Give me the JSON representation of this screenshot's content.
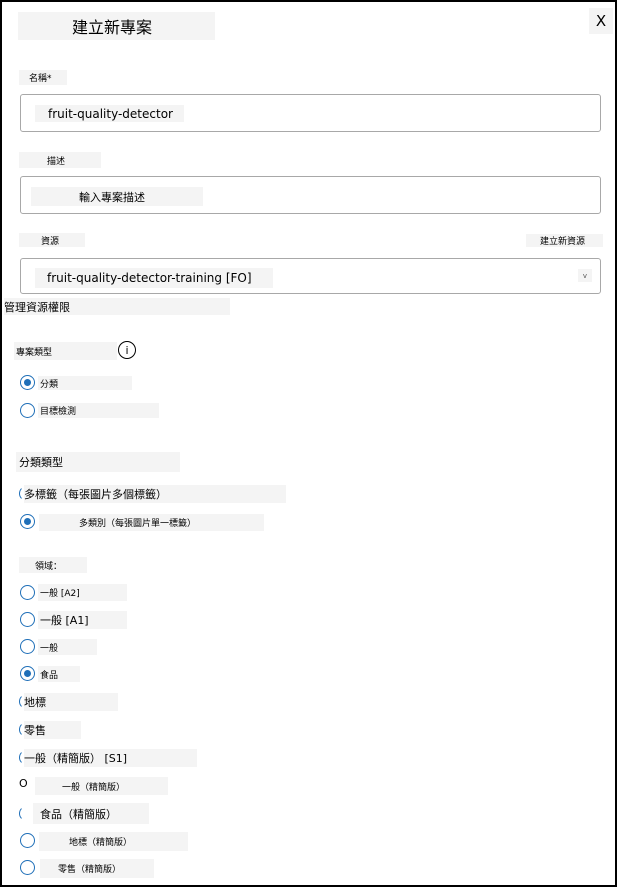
{
  "dialog": {
    "title": "建立新專案",
    "close_label": "X"
  },
  "name": {
    "label": "名稱*",
    "value": "fruit-quality-detector"
  },
  "description": {
    "label": "描述",
    "placeholder": "輸入專案描述"
  },
  "resource": {
    "label": "資源",
    "create_link": "建立新資源",
    "selected": "fruit-quality-detector-training [FO]",
    "chevron": "v",
    "manage_link": "管理資源權限"
  },
  "project_type": {
    "label": "專案類型",
    "info_glyph": "i",
    "options": [
      {
        "label": "分類",
        "selected": true
      },
      {
        "label": "目標檢測",
        "selected": false
      }
    ]
  },
  "classification_type": {
    "label": "分類類型",
    "options": [
      {
        "label": "多標籤（每張圖片多個標籤）",
        "selected": false
      },
      {
        "label": "多類別（每張圖片單一標籤）",
        "selected": true
      }
    ]
  },
  "domains": {
    "label": "領域：",
    "options": [
      {
        "label": "一般 [A2]",
        "selected": false
      },
      {
        "label": "一般 [A1]",
        "selected": false
      },
      {
        "label": "一般",
        "selected": false
      },
      {
        "label": "食品",
        "selected": true
      },
      {
        "label": "地標",
        "selected": false
      },
      {
        "label": "零售",
        "selected": false
      },
      {
        "label": "一般（精簡版） [S1]",
        "selected": false
      },
      {
        "label": "一般（精簡版）",
        "selected": false,
        "marker": "O"
      },
      {
        "label": "食品（精簡版）",
        "selected": false
      },
      {
        "label": "地標（精簡版）",
        "selected": false
      },
      {
        "label": "零售（精簡版）",
        "selected": false
      }
    ]
  },
  "colors": {
    "accent": "#1f6fb8",
    "label_bg": "#f4f4f4",
    "border": "#a8a8a8"
  }
}
